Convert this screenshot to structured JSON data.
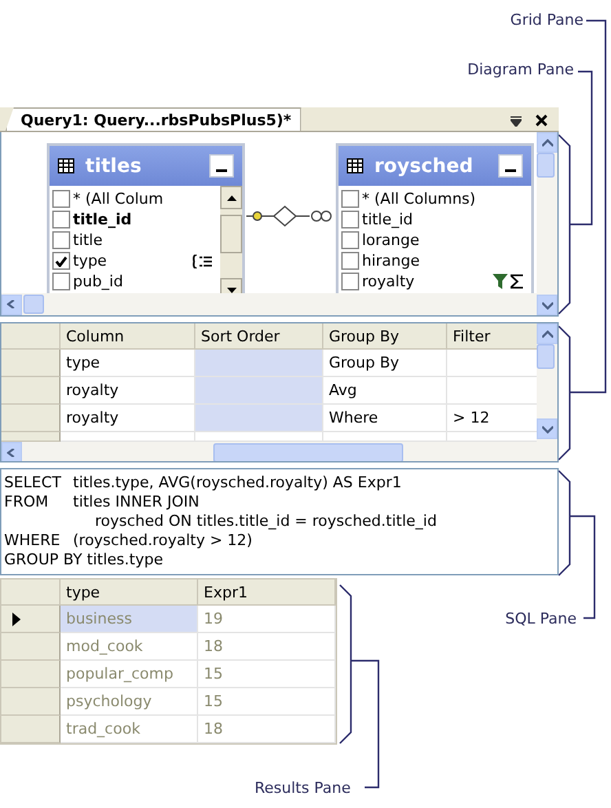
{
  "callouts": [
    {
      "label": "Grid Pane",
      "kind": "grid"
    },
    {
      "label": "Diagram Pane",
      "kind": "diagram"
    },
    {
      "label": "SQL Pane",
      "kind": "sql"
    },
    {
      "label": "Results Pane",
      "kind": "results"
    }
  ],
  "document_tab": {
    "title": "Query1: Query...rbsPubsPlus5)*"
  },
  "diagram": {
    "tables": [
      {
        "name": "titles",
        "scrollable": true,
        "columns": [
          {
            "name": "* (All Colum",
            "checked": false,
            "key": false
          },
          {
            "name": "title_id",
            "checked": false,
            "key": true
          },
          {
            "name": "title",
            "checked": false,
            "key": false
          },
          {
            "name": "type",
            "checked": true,
            "key": false,
            "indicators": [
              {
                "kind": "group"
              }
            ]
          },
          {
            "name": "pub_id",
            "checked": false,
            "key": false
          }
        ]
      },
      {
        "name": "roysched",
        "scrollable": false,
        "columns": [
          {
            "name": "* (All Columns)",
            "checked": false,
            "key": false
          },
          {
            "name": "title_id",
            "checked": false,
            "key": false
          },
          {
            "name": "lorange",
            "checked": false,
            "key": false
          },
          {
            "name": "hirange",
            "checked": false,
            "key": false
          },
          {
            "name": "royalty",
            "checked": false,
            "key": false,
            "indicators": [
              {
                "kind": "filter"
              },
              {
                "kind": "sum"
              }
            ]
          }
        ]
      }
    ]
  },
  "grid": {
    "columns": [
      "Column",
      "Sort Order",
      "Group By",
      "Filter"
    ],
    "rows": [
      {
        "column": "type",
        "group_by": "Group By"
      },
      {
        "column": "royalty",
        "group_by": "Avg"
      },
      {
        "column": "royalty",
        "group_by": "Where",
        "filter": "> 12"
      }
    ]
  },
  "sql": {
    "lines": [
      {
        "kind": "clause",
        "keyword": "SELECT",
        "text": "titles.type, AVG(roysched.royalty) AS Expr1"
      },
      {
        "kind": "clause",
        "keyword": "FROM",
        "text": "titles INNER JOIN"
      },
      {
        "kind": "continuation",
        "text": "roysched ON titles.title_id = roysched.title_id"
      },
      {
        "kind": "clause",
        "keyword": "WHERE",
        "text": "(roysched.royalty > 12)"
      },
      {
        "kind": "whole",
        "text": "GROUP BY titles.type"
      }
    ]
  },
  "results": {
    "columns": [
      "type",
      "Expr1"
    ],
    "rows": [
      {
        "cells": [
          "business",
          "19"
        ],
        "selected": true
      },
      {
        "cells": [
          "mod_cook",
          "18"
        ],
        "selected": false
      },
      {
        "cells": [
          "popular_comp",
          "15"
        ],
        "selected": false
      },
      {
        "cells": [
          "psychology",
          "15"
        ],
        "selected": false
      },
      {
        "cells": [
          "trad_cook",
          "18"
        ],
        "selected": false
      }
    ]
  }
}
